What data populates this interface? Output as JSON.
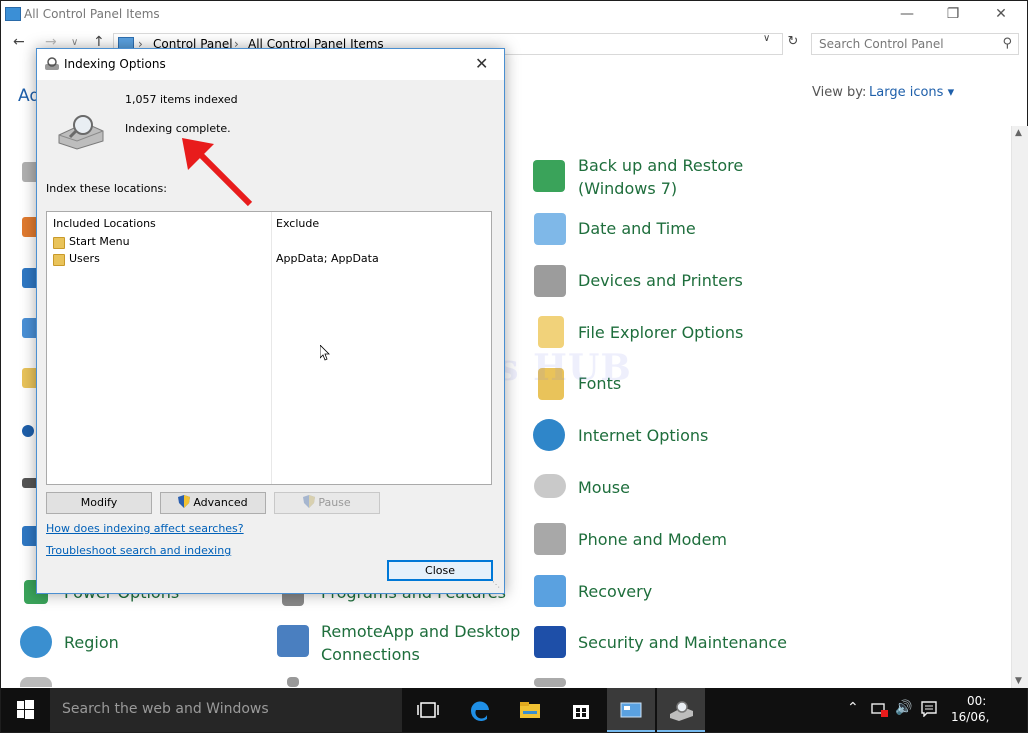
{
  "window": {
    "title": "All Control Panel Items",
    "breadcrumb": [
      "Control Panel",
      "All Control Panel Items"
    ],
    "search_placeholder": "Search Control Panel",
    "heading_partial": "Ad",
    "view_by_label": "View by:",
    "view_by_value": "Large icons ▾"
  },
  "items_right": [
    {
      "label": "Back up and Restore\n(Windows 7)",
      "icon": "backup-icon"
    },
    {
      "label": "Date and Time",
      "icon": "calendar-clock-icon"
    },
    {
      "label": "Devices and Printers",
      "icon": "printer-icon"
    },
    {
      "label": "File Explorer Options",
      "icon": "folder-options-icon"
    },
    {
      "label": "Fonts",
      "icon": "fonts-folder-icon"
    },
    {
      "label": "Internet Options",
      "icon": "globe-icon"
    },
    {
      "label": "Mouse",
      "icon": "mouse-icon"
    },
    {
      "label": "Phone and Modem",
      "icon": "phone-icon"
    },
    {
      "label": "Recovery",
      "icon": "recovery-icon"
    },
    {
      "label": "Security and Maintenance",
      "icon": "flag-icon"
    }
  ],
  "items_bottom": {
    "power_options": "Power Options",
    "programs_features": "Programs and Features",
    "region": "Region",
    "remoteapp": "RemoteApp and Desktop\nConnections"
  },
  "dialog": {
    "title": "Indexing Options",
    "items_indexed": "1,057 items indexed",
    "status": "Indexing complete.",
    "locations_label": "Index these locations:",
    "columns": {
      "included": "Included Locations",
      "exclude": "Exclude"
    },
    "locations": [
      {
        "name": "Start Menu",
        "exclude": ""
      },
      {
        "name": "Users",
        "exclude": "AppData; AppData"
      }
    ],
    "buttons": {
      "modify": "Modify",
      "advanced": "Advanced",
      "pause": "Pause",
      "close": "Close"
    },
    "links": {
      "how": "How does indexing affect searches?",
      "troubleshoot": "Troubleshoot search and indexing"
    }
  },
  "watermark": "IT Pros HUB",
  "taskbar": {
    "search_placeholder": "Search the web and Windows",
    "clock_time": "00:",
    "clock_date": "16/06,"
  },
  "colors": {
    "link_blue": "#0060b8",
    "cp_item_green": "#1e6e3c",
    "accent": "#0078d7",
    "arrow_red": "#e81c1c"
  }
}
